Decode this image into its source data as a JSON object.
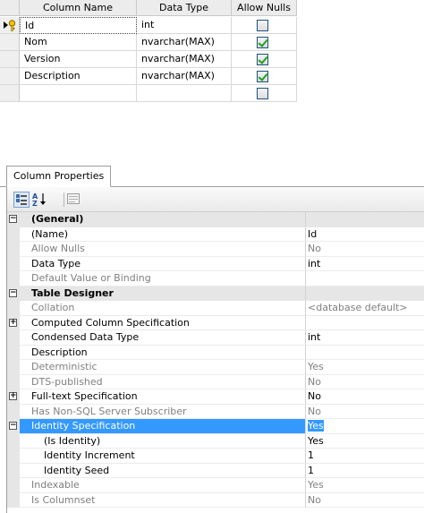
{
  "grid": {
    "headers": {
      "column_name": "Column Name",
      "data_type": "Data Type",
      "allow_nulls": "Allow Nulls"
    },
    "rows": [
      {
        "name": "Id",
        "type": "int",
        "allow_nulls": false,
        "primary_key": true
      },
      {
        "name": "Nom",
        "type": "nvarchar(MAX)",
        "allow_nulls": true
      },
      {
        "name": "Version",
        "type": "nvarchar(MAX)",
        "allow_nulls": true
      },
      {
        "name": "Description",
        "type": "nvarchar(MAX)",
        "allow_nulls": true
      },
      {
        "name": "",
        "type": "",
        "allow_nulls": false
      }
    ]
  },
  "properties_panel": {
    "tab_label": "Column Properties",
    "toolbar": [
      "categorized-icon",
      "alphabetical-sort-icon",
      "property-pages-icon"
    ],
    "rows": [
      {
        "kind": "category",
        "name": "(General)",
        "value": ""
      },
      {
        "name": "(Name)",
        "value": "Id"
      },
      {
        "name": "Allow Nulls",
        "value": "No",
        "disabled": true
      },
      {
        "name": "Data Type",
        "value": "int"
      },
      {
        "name": "Default Value or Binding",
        "value": "",
        "disabled": true
      },
      {
        "kind": "category",
        "name": "Table Designer",
        "value": ""
      },
      {
        "name": "Collation",
        "value": "<database default>",
        "disabled": true
      },
      {
        "name": "Computed Column Specification",
        "value": "",
        "expandable": true
      },
      {
        "name": "Condensed Data Type",
        "value": "int"
      },
      {
        "name": "Description",
        "value": ""
      },
      {
        "name": "Deterministic",
        "value": "Yes",
        "disabled": true
      },
      {
        "name": "DTS-published",
        "value": "No",
        "disabled": true
      },
      {
        "name": "Full-text Specification",
        "value": "No",
        "expandable": true
      },
      {
        "name": "Has Non-SQL Server Subscriber",
        "value": "No",
        "disabled": true
      },
      {
        "name": "Identity Specification",
        "value": "Yes",
        "expandable": true,
        "expanded": true,
        "selected": true
      },
      {
        "name": "(Is Identity)",
        "value": "Yes",
        "child": true
      },
      {
        "name": "Identity Increment",
        "value": "1",
        "child": true
      },
      {
        "name": "Identity Seed",
        "value": "1",
        "child": true
      },
      {
        "name": "Indexable",
        "value": "Yes",
        "disabled": true
      },
      {
        "name": "Is Columnset",
        "value": "No",
        "disabled": true
      }
    ]
  },
  "colors": {
    "selection": "#3399ff",
    "disabled_text": "#808080",
    "checkbox_check": "#21a121"
  }
}
